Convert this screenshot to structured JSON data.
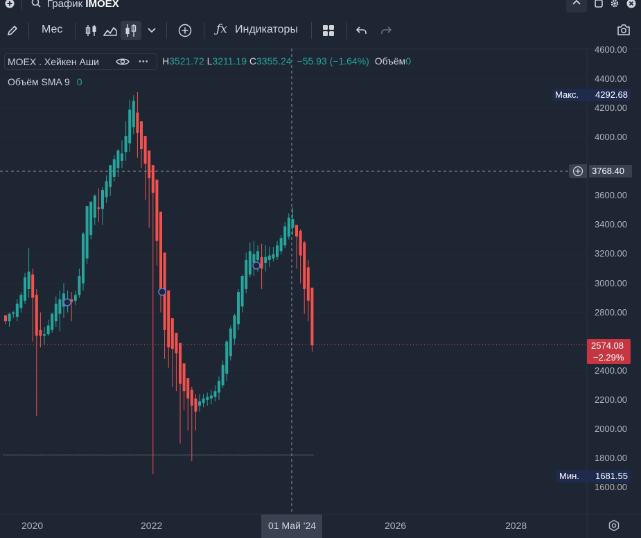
{
  "topbar": {
    "title_prefix": "График",
    "symbol": "IMOEX"
  },
  "toolbar": {
    "interval": "Мес",
    "indicators": "Индикаторы"
  },
  "legend": {
    "symbol_name": "MOEX . Хейкен Аши",
    "more": "•••",
    "h_label": "H",
    "h_value": "3521.72",
    "l_label": "L",
    "l_value": "3211.19",
    "c_label": "C",
    "c_value": "3355.24",
    "change": "−55.93 (−1.64%)",
    "vol_label": "Объём",
    "vol_value": "0",
    "sma_label": "Объём SMA 9",
    "sma_value": "0"
  },
  "price_axis": {
    "ticks": [
      "4600.00",
      "4400.00",
      "4200.00",
      "4000.00",
      "3600.00",
      "3400.00",
      "3200.00",
      "3000.00",
      "2800.00",
      "2400.00",
      "2200.00",
      "2000.00",
      "1800.00",
      "1600.00"
    ],
    "max_label": "Макс.",
    "max_value": "4292.68",
    "crosshair_value": "3768.40",
    "last_value": "2574.08",
    "last_change": "−2.29%",
    "min_label": "Мин.",
    "min_value": "1681.55"
  },
  "time_axis": {
    "labels": [
      "2020",
      "2022",
      "2026",
      "2028"
    ],
    "crosshair_label": "01 Май '24"
  },
  "colors": {
    "up": "#26a69a",
    "down": "#ef5350",
    "accent": "#2962ff",
    "background": "#1e2533"
  },
  "chart_data": {
    "type": "candlestick",
    "style": "Heikin Ashi",
    "interval": "1M",
    "ylim": [
      1500,
      4650
    ],
    "x_ticks": [
      "2020",
      "2022",
      "2026",
      "2028"
    ],
    "series": [
      {
        "values": [
          [
            2780,
            2740,
            2750,
            2720
          ],
          [
            2740,
            2790,
            2800,
            2700
          ],
          [
            2790,
            2800,
            2810,
            2760
          ],
          [
            2770,
            2860,
            2890,
            2740
          ],
          [
            2830,
            2920,
            2940,
            2800
          ],
          [
            2880,
            3040,
            3070,
            2860
          ],
          [
            2960,
            3080,
            3240,
            2900
          ],
          [
            3060,
            2900,
            3100,
            2600
          ],
          [
            2920,
            2640,
            2960,
            2090
          ],
          [
            2680,
            2640,
            2800,
            2560
          ],
          [
            2640,
            2650,
            2700,
            2580
          ],
          [
            2650,
            2710,
            2750,
            2640
          ],
          [
            2680,
            2790,
            2800,
            2660
          ],
          [
            2740,
            2860,
            2910,
            2700
          ],
          [
            2790,
            2890,
            2950,
            2670
          ],
          [
            2840,
            2930,
            3000,
            2760
          ],
          [
            2880,
            2880,
            2950,
            2800
          ],
          [
            2890,
            2870,
            2940,
            2740
          ],
          [
            2880,
            2920,
            2950,
            2850
          ],
          [
            2920,
            3050,
            3100,
            2900
          ],
          [
            3000,
            3340,
            3350,
            2950
          ],
          [
            3170,
            3530,
            3530,
            3130
          ],
          [
            3330,
            3560,
            3560,
            3300
          ],
          [
            3450,
            3600,
            3610,
            3400
          ],
          [
            3520,
            3510,
            3650,
            3420
          ],
          [
            3510,
            3640,
            3660,
            3400
          ],
          [
            3590,
            3700,
            3740,
            3550
          ],
          [
            3660,
            3810,
            3800,
            3600
          ],
          [
            3730,
            3850,
            3880,
            3700
          ],
          [
            3790,
            3910,
            3920,
            3730
          ],
          [
            3840,
            3890,
            3980,
            3790
          ],
          [
            3900,
            4010,
            4110,
            3840
          ],
          [
            3960,
            4190,
            4260,
            3900
          ],
          [
            4070,
            4250,
            4290,
            4020
          ],
          [
            4170,
            4030,
            4310,
            3860
          ],
          [
            4110,
            3920,
            4110,
            3790
          ],
          [
            4010,
            3820,
            4010,
            3570
          ],
          [
            3910,
            3720,
            3910,
            3380
          ],
          [
            3810,
            3620,
            3810,
            1690
          ],
          [
            3710,
            3290,
            3710,
            3120
          ],
          [
            3490,
            2950,
            3490,
            2800
          ],
          [
            3210,
            2680,
            3210,
            2480
          ],
          [
            2950,
            2560,
            2950,
            2420
          ],
          [
            2760,
            2550,
            2760,
            2290
          ],
          [
            2660,
            2520,
            2660,
            2260
          ],
          [
            2590,
            2310,
            2590,
            1900
          ],
          [
            2450,
            2260,
            2450,
            2130
          ],
          [
            2350,
            2210,
            2350,
            1990
          ],
          [
            2270,
            2160,
            2290,
            1780
          ],
          [
            2210,
            2120,
            2240,
            1990
          ],
          [
            2160,
            2190,
            2240,
            2120
          ],
          [
            2180,
            2210,
            2240,
            2150
          ],
          [
            2200,
            2220,
            2250,
            2160
          ],
          [
            2210,
            2230,
            2270,
            2170
          ],
          [
            2220,
            2260,
            2300,
            2190
          ],
          [
            2250,
            2330,
            2360,
            2200
          ],
          [
            2300,
            2440,
            2470,
            2280
          ],
          [
            2380,
            2600,
            2610,
            2330
          ],
          [
            2500,
            2690,
            2710,
            2470
          ],
          [
            2620,
            2780,
            2790,
            2580
          ],
          [
            2720,
            2940,
            2960,
            2680
          ],
          [
            2840,
            3050,
            3060,
            2800
          ],
          [
            2960,
            3160,
            3210,
            2930
          ],
          [
            3060,
            3220,
            3280,
            3040
          ],
          [
            3140,
            3200,
            3290,
            3050
          ],
          [
            3160,
            3220,
            3260,
            3080
          ],
          [
            3180,
            3100,
            3270,
            2960
          ],
          [
            3140,
            3180,
            3260,
            3080
          ],
          [
            3160,
            3190,
            3250,
            3110
          ],
          [
            3170,
            3200,
            3250,
            3150
          ],
          [
            3180,
            3260,
            3290,
            3160
          ],
          [
            3220,
            3310,
            3330,
            3200
          ],
          [
            3260,
            3390,
            3420,
            3240
          ],
          [
            3320,
            3450,
            3480,
            3300
          ],
          [
            3380,
            3440,
            3520,
            3330
          ],
          [
            3400,
            3320,
            3400,
            3100
          ],
          [
            3360,
            3190,
            3370,
            3000
          ],
          [
            3280,
            2960,
            3290,
            2790
          ],
          [
            3110,
            2880,
            3160,
            2740
          ],
          [
            2970,
            2574,
            2970,
            2530
          ]
        ]
      }
    ]
  }
}
